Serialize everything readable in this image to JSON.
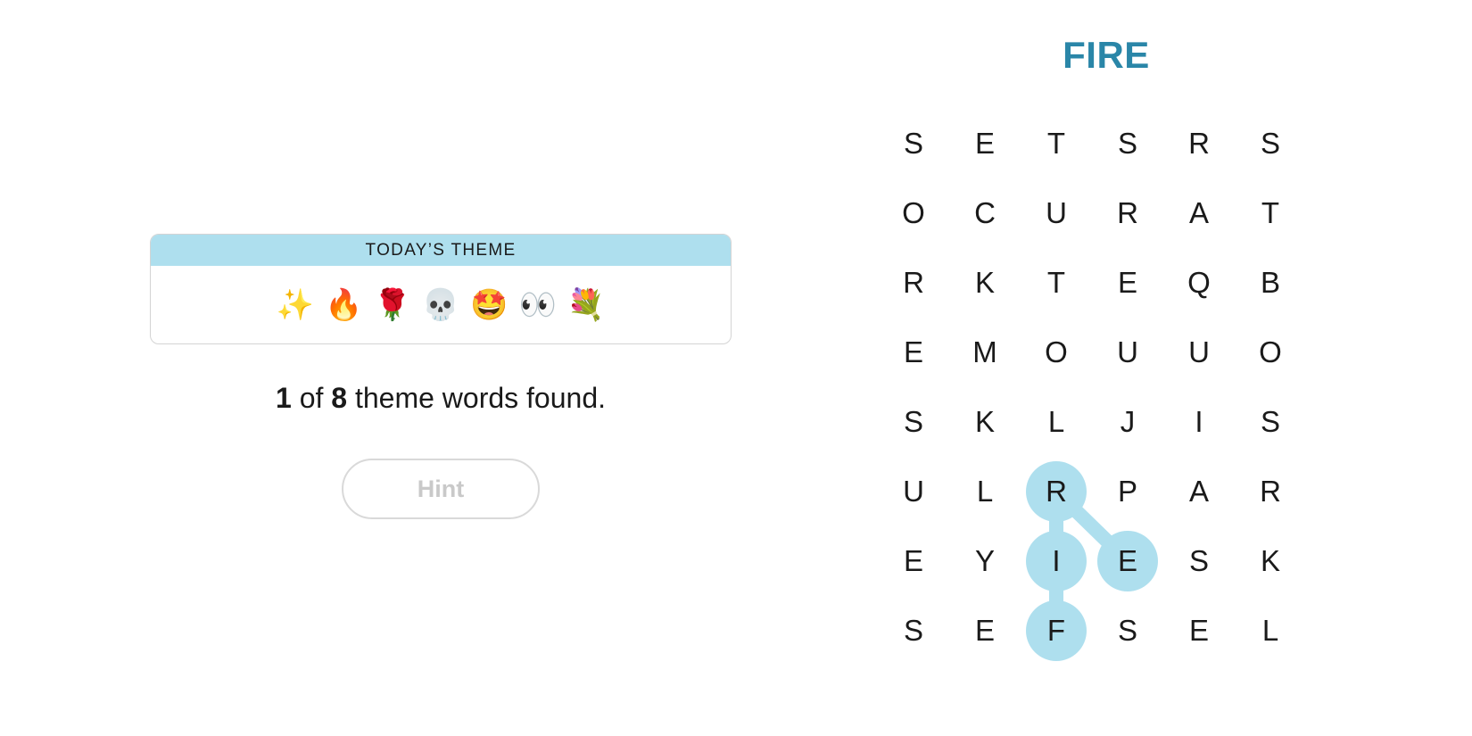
{
  "theme": {
    "header": "TODAY’S THEME",
    "emojis": [
      "✨",
      "🔥",
      "🌹",
      "💀",
      "🤩",
      "👀",
      "💐"
    ]
  },
  "progress": {
    "found": "1",
    "of_label": "of",
    "total": "8",
    "suffix": "theme words found."
  },
  "hint_button": {
    "label": "Hint",
    "enabled": false
  },
  "current_word": "FIRE",
  "colors": {
    "accent": "#2a86a8",
    "selection": "#aedfee",
    "theme_header_bg": "#aedfee"
  },
  "grid": [
    [
      "S",
      "E",
      "T",
      "S",
      "R",
      "S"
    ],
    [
      "O",
      "C",
      "U",
      "R",
      "A",
      "T"
    ],
    [
      "R",
      "K",
      "T",
      "E",
      "Q",
      "B"
    ],
    [
      "E",
      "M",
      "O",
      "U",
      "U",
      "O"
    ],
    [
      "S",
      "K",
      "L",
      "J",
      "I",
      "S"
    ],
    [
      "U",
      "L",
      "R",
      "P",
      "A",
      "R"
    ],
    [
      "E",
      "Y",
      "I",
      "E",
      "S",
      "K"
    ],
    [
      "S",
      "E",
      "F",
      "S",
      "E",
      "L"
    ]
  ],
  "selected_path": [
    [
      7,
      2
    ],
    [
      6,
      2
    ],
    [
      5,
      2
    ],
    [
      6,
      3
    ]
  ]
}
